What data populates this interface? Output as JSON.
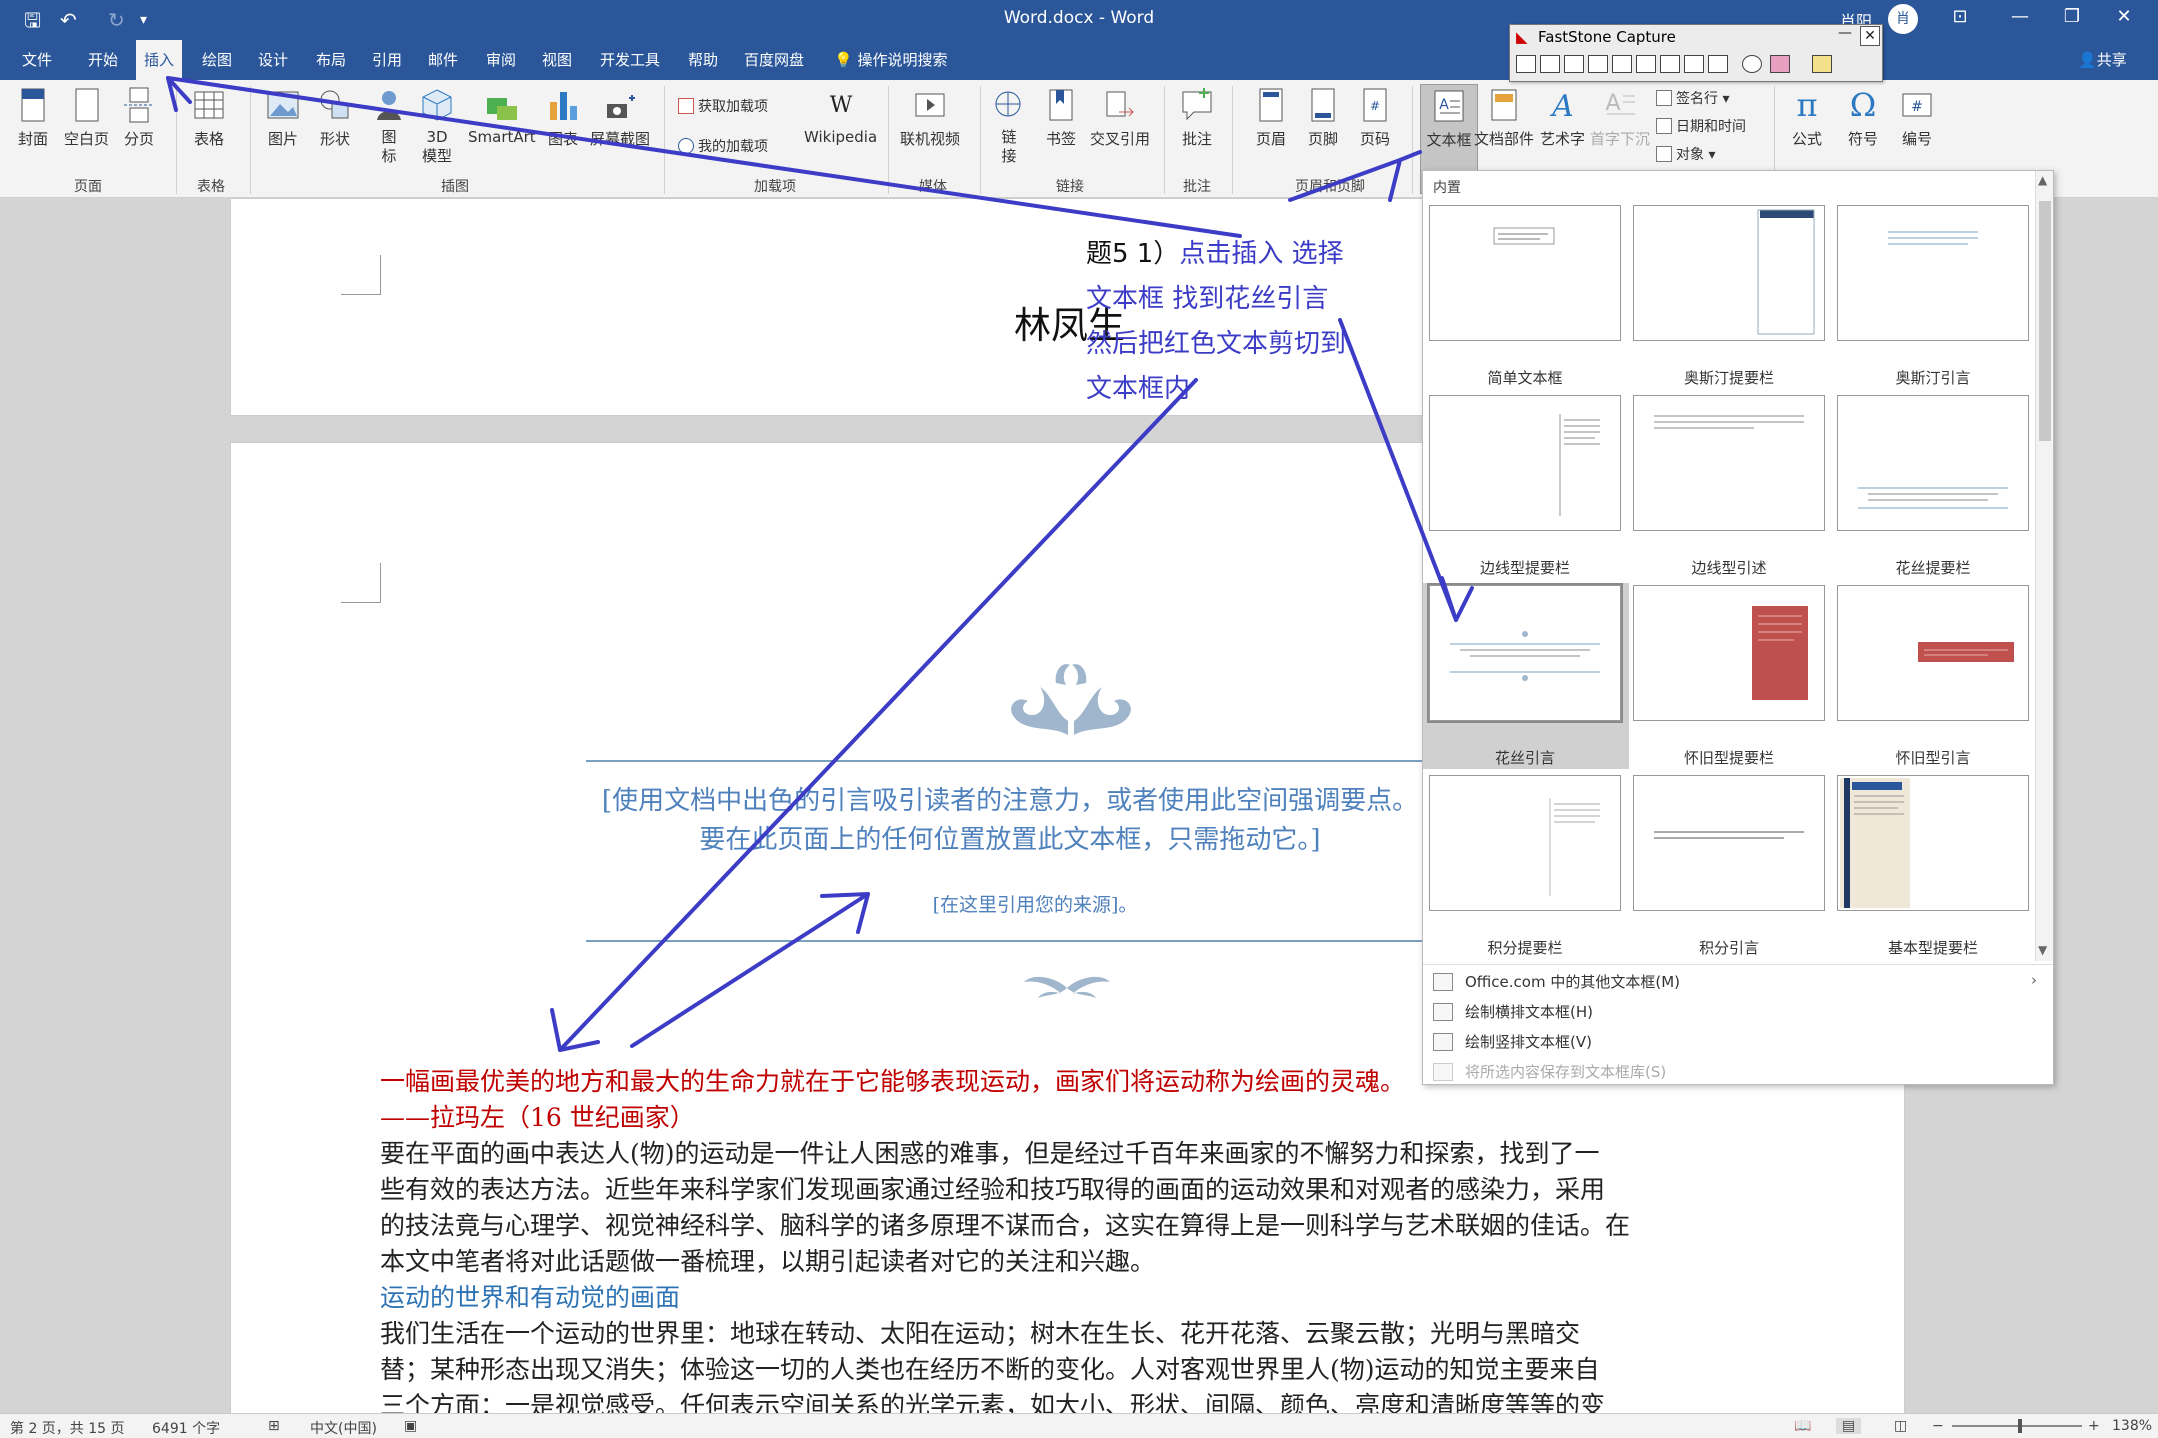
{
  "titlebar": {
    "doc_title": "Word.docx  -  Word",
    "user_name": "肖阳",
    "user_initial": "肖"
  },
  "menu": {
    "tabs": [
      "文件",
      "开始",
      "插入",
      "绘图",
      "设计",
      "布局",
      "引用",
      "邮件",
      "审阅",
      "视图",
      "开发工具",
      "帮助",
      "百度网盘"
    ],
    "active": "插入",
    "tell_me": "操作说明搜索",
    "share": "共享"
  },
  "ribbon": {
    "buttons": {
      "cover": "封面",
      "blank": "空白页",
      "break": "分页",
      "table": "表格",
      "picture": "图片",
      "shapes": "形状",
      "icons": "图\n标",
      "model3d": "3D\n模型",
      "smartart": "SmartArt",
      "chart": "图表",
      "screenshot": "屏幕截图",
      "wikipedia": "Wikipedia",
      "video": "联机视频",
      "link": "链\n接",
      "bookmark": "书签",
      "crossref": "交叉引用",
      "comment": "批注",
      "header": "页眉",
      "footer": "页脚",
      "pagenum": "页码",
      "textbox": "文本框",
      "quickparts": "文档部件",
      "wordart": "艺术字",
      "dropcap": "首字下沉",
      "equation": "公式",
      "symbol": "符号",
      "number": "编号"
    },
    "small": {
      "get_addins": "获取加载项",
      "my_addins": "我的加载项",
      "signature": "签名行",
      "datetime": "日期和时间",
      "object": "对象"
    },
    "groups": {
      "pages": "页面",
      "tables": "表格",
      "illustrations": "插图",
      "addins": "加载项",
      "media": "媒体",
      "links": "链接",
      "comments": "批注",
      "headerfooter": "页眉和页脚"
    }
  },
  "faststone": {
    "title": "FastStone Capture"
  },
  "document": {
    "author": "林凤生",
    "annotation": {
      "prefix": "题5 1）",
      "lines": [
        "点击插入 选择",
        "文本框 找到花丝引言",
        "然后把红色文本剪切到",
        "文本框内"
      ]
    },
    "quote": "[使用文档中出色的引言吸引读者的注意力，或者使用此空间强调要点。要在此页面上的任何位置放置此文本框，只需拖动它。]",
    "quote_source": "[在这里引用您的来源]。",
    "red_line1": "一幅画最优美的地方和最大的生命力就在于它能够表现运动，画家们将运动称为绘画的灵魂。",
    "red_line2": "——拉玛左（16 世纪画家）",
    "para1": [
      "要在平面的画中表达人(物)的运动是一件让人困惑的难事，但是经过千百年来画家的不懈努力和探索，找到了一",
      "些有效的表达方法。近些年来科学家们发现画家通过经验和技巧取得的画面的运动效果和对观者的感染力，采用",
      "的技法竟与心理学、视觉神经科学、脑科学的诸多原理不谋而合，这实在算得上是一则科学与艺术联姻的佳话。在",
      "本文中笔者将对此话题做一番梳理，以期引起读者对它的关注和兴趣。"
    ],
    "heading": "运动的世界和有动觉的画面",
    "para2": [
      "我们生活在一个运动的世界里：地球在转动、太阳在运动；树木在生长、花开花落、云聚云散；光明与黑暗交",
      "替；某种形态出现又消失；体验这一切的人类也在经历不断的变化。人对客观世界里人(物)运动的知觉主要来自",
      "三个方面：一是视觉感受。任何表示空间关系的光学元素，如大小、形状、间隔、颜色、亮度和清晰度等等的变"
    ]
  },
  "gallery": {
    "section": "内置",
    "items": [
      "简单文本框",
      "奥斯汀提要栏",
      "奥斯汀引言",
      "边线型提要栏",
      "边线型引述",
      "花丝提要栏",
      "花丝引言",
      "怀旧型提要栏",
      "怀旧型引言",
      "积分提要栏",
      "积分引言",
      "基本型提要栏"
    ],
    "selected": "花丝引言",
    "menu": [
      "Office.com 中的其他文本框(M)",
      "绘制横排文本框(H)",
      "绘制竖排文本框(V)",
      "将所选内容保存到文本框库(S)"
    ]
  },
  "statusbar": {
    "page": "第 2 页，共 15 页",
    "words": "6491 个字",
    "language": "中文(中国)",
    "zoom": "138%"
  },
  "colors": {
    "accent": "#2b579a",
    "annotation": "#3c3cc6",
    "red_text": "#c00000",
    "quote": "#4f81bd",
    "heading": "#2e74b5"
  }
}
